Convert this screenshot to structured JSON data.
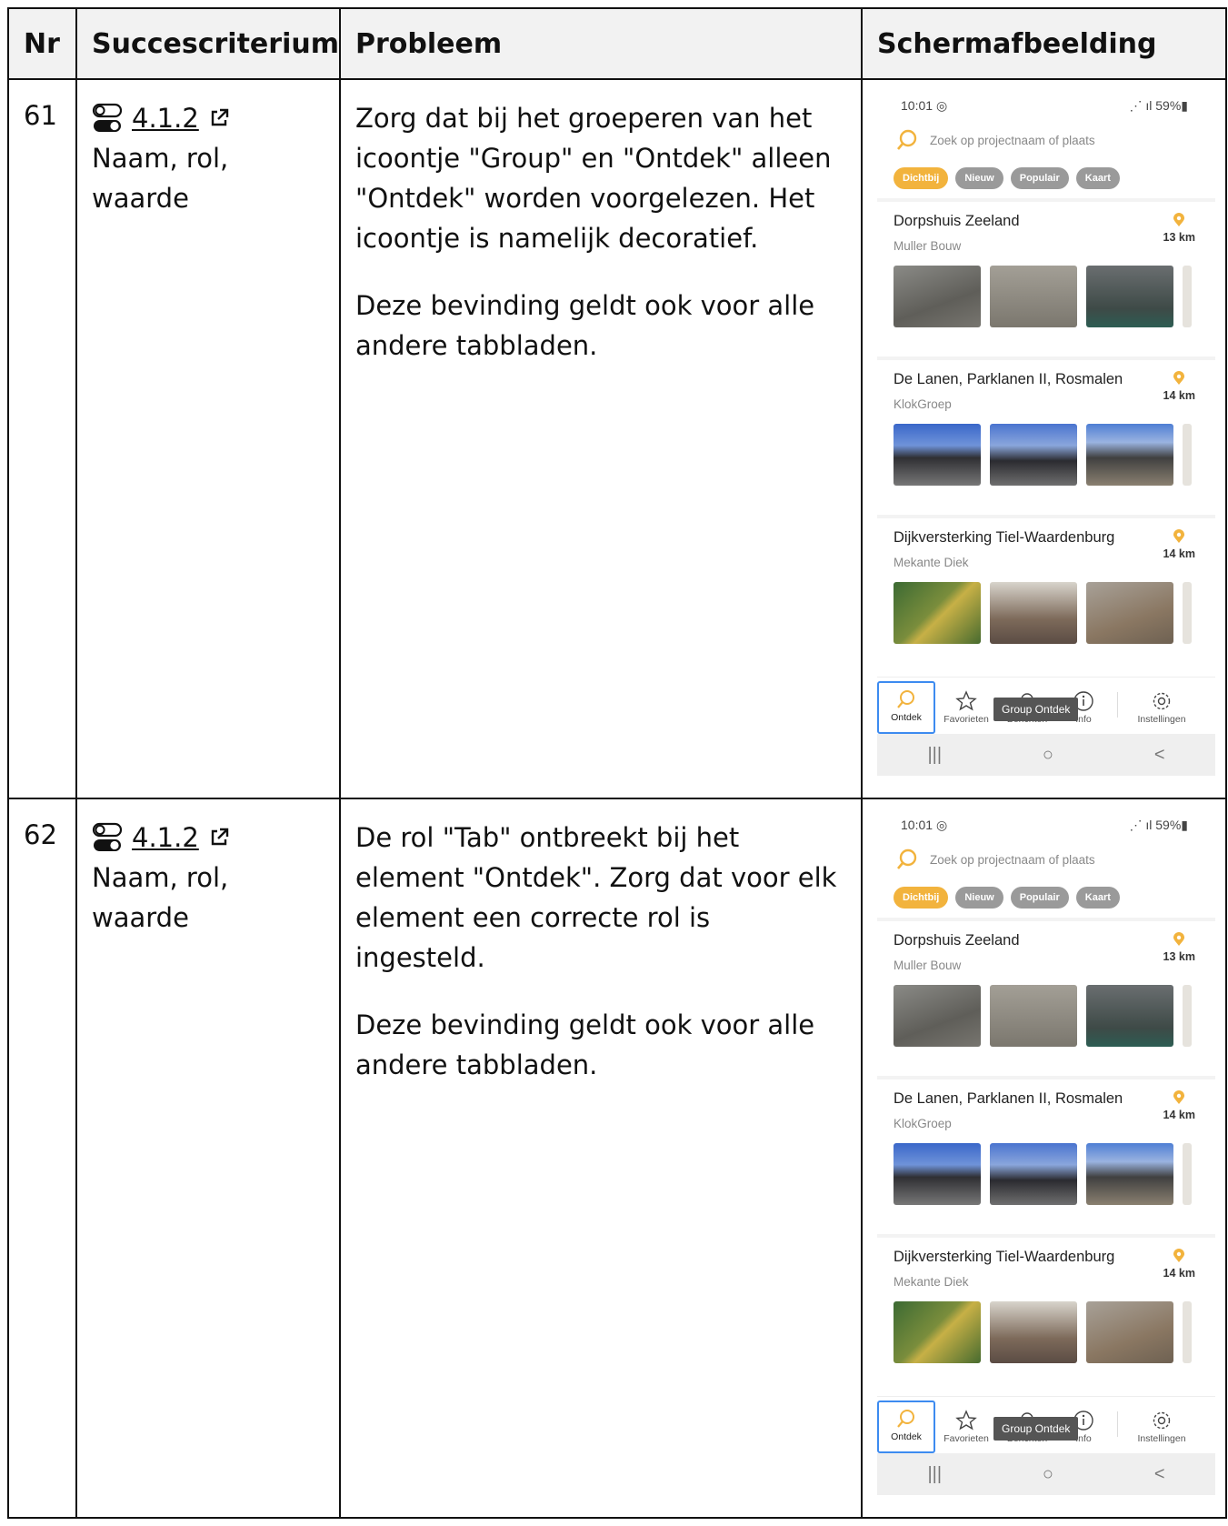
{
  "table": {
    "headers": {
      "nr": "Nr",
      "criterium": "Succescriterium",
      "probleem": "Probleem",
      "schermafbeelding": "Schermafbeelding"
    },
    "rows": [
      {
        "nr": "61",
        "criterium_code": "4.1.2",
        "criterium_name": "Naam, rol, waarde",
        "probleem": [
          "Zorg dat bij het groeperen van het icoontje \"Group\" en \"Ontdek\" alleen \"Ontdek\" worden voorgelezen. Het icoontje is namelijk decoratief.",
          "Deze bevinding geldt ook voor alle andere tabbladen."
        ]
      },
      {
        "nr": "62",
        "criterium_code": "4.1.2",
        "criterium_name": "Naam, rol, waarde",
        "probleem": [
          "De rol \"Tab\" ontbreekt bij het element \"Ontdek\". Zorg dat voor elk element een correcte rol is ingesteld.",
          "Deze bevinding geldt ook voor alle andere tabbladen."
        ]
      }
    ]
  },
  "phone": {
    "time": "10:01",
    "battery": "59%",
    "search_placeholder": "Zoek op projectnaam of plaats",
    "chips": [
      "Dichtbij",
      "Nieuw",
      "Populair",
      "Kaart"
    ],
    "projects": [
      {
        "title": "Dorpshuis Zeeland",
        "company": "Muller Bouw",
        "distance": "13 km"
      },
      {
        "title": "De Lanen, Parklanen II, Rosmalen",
        "company": "KlokGroep",
        "distance": "14 km"
      },
      {
        "title": "Dijkversterking Tiel-Waardenburg",
        "company": "Mekante Diek",
        "distance": "14 km"
      }
    ],
    "tabs": [
      "Ontdek",
      "Favorieten",
      "Berichten",
      "Info",
      "Instellingen"
    ],
    "tooltip": "Group Ontdek",
    "nav": [
      "|||",
      "○",
      "<"
    ]
  },
  "colors": {
    "accent": "#f2b33d",
    "focus": "#3d8bf0"
  }
}
